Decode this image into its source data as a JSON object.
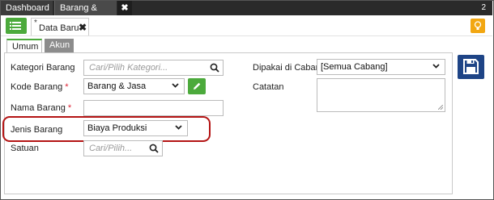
{
  "topbar": {
    "tabs": [
      {
        "label": "Dashboard"
      },
      {
        "label": "Barang & Jasa"
      }
    ],
    "close_label": "✖",
    "count": "2"
  },
  "doc_tab": {
    "modified_mark": "*",
    "label": "Data Baru",
    "close_label": "✖"
  },
  "subtabs": [
    {
      "label": "Umum",
      "active": true
    },
    {
      "label": "Akun",
      "active": false
    }
  ],
  "form": {
    "kategori": {
      "label": "Kategori Barang",
      "placeholder": "Cari/Pilih Kategori..."
    },
    "kode": {
      "label": "Kode Barang",
      "required_mark": "*",
      "value": "Barang & Jasa"
    },
    "nama": {
      "label": "Nama Barang",
      "required_mark": "*",
      "value": ""
    },
    "jenis": {
      "label": "Jenis Barang",
      "value": "Biaya Produksi"
    },
    "satuan": {
      "label": "Satuan",
      "placeholder": "Cari/Pilih..."
    },
    "dipakai": {
      "label": "Dipakai di Cabang",
      "value": "[Semua Cabang]"
    },
    "catatan": {
      "label": "Catatan",
      "value": ""
    }
  },
  "colors": {
    "accent_green": "#4caa3c",
    "save_blue": "#1e4486",
    "bulb_orange": "#f2a712",
    "highlight_red": "#b41414",
    "required_red": "#dd2233"
  },
  "icons": [
    "list-menu-icon",
    "close-icon",
    "lightbulb-icon",
    "search-icon",
    "chevron-down-icon",
    "pencil-icon",
    "save-icon",
    "resize-grip-icon"
  ]
}
